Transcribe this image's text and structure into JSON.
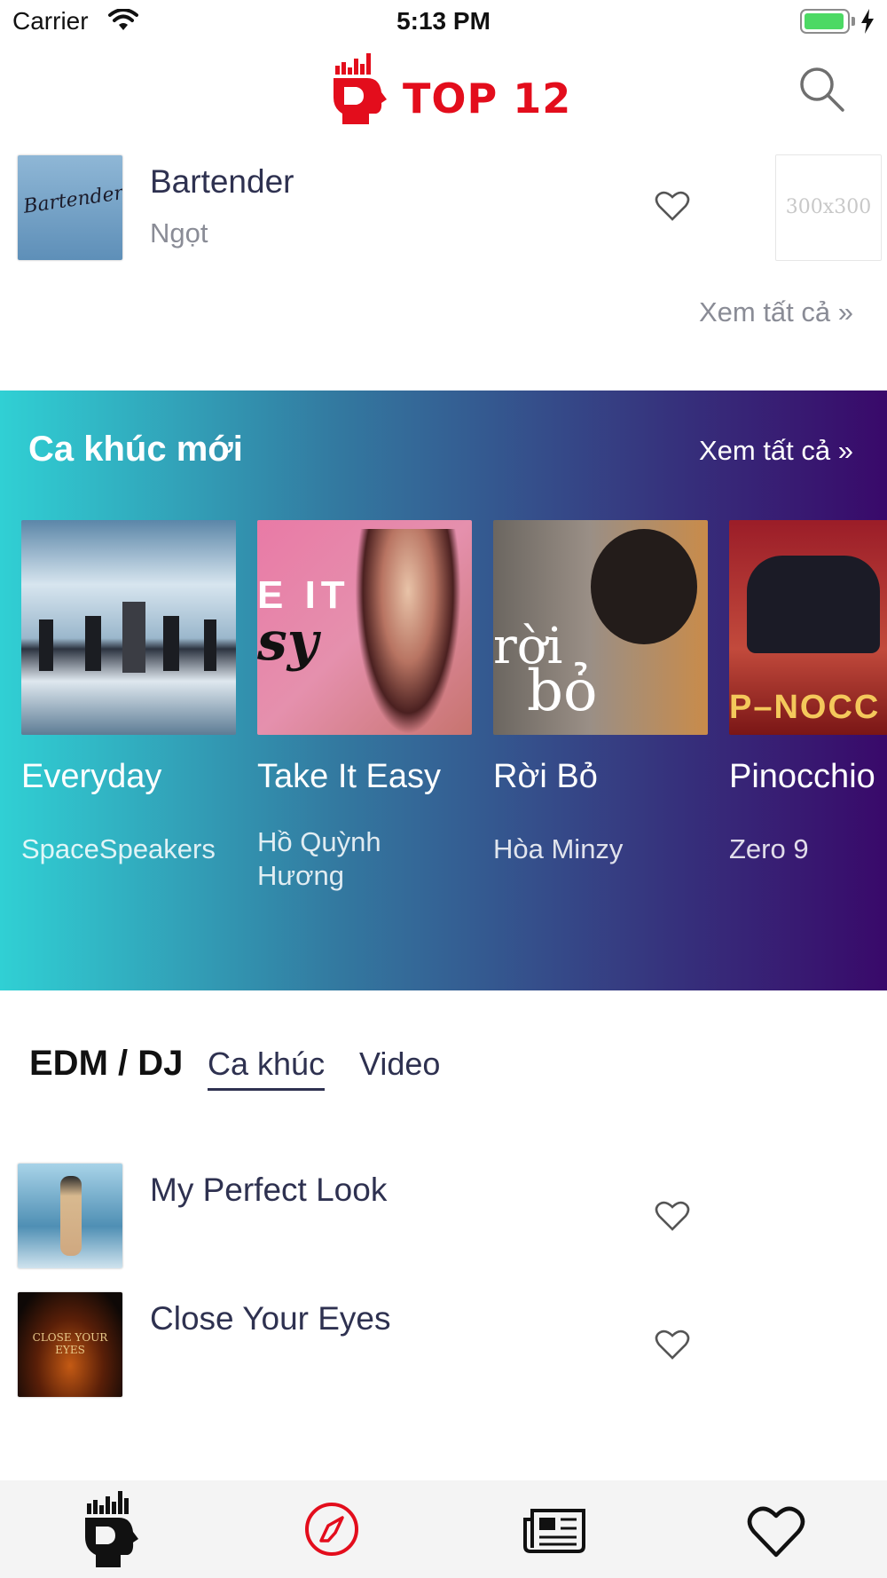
{
  "status_bar": {
    "carrier": "Carrier",
    "time": "5:13 PM"
  },
  "header": {
    "logo_text": "TOP 12"
  },
  "top_song": {
    "title": "Bartender",
    "artist": "Ngọt",
    "cover_text": "Bartender",
    "placeholder": "300x300"
  },
  "see_all": "Xem tất cả »",
  "new_songs": {
    "title": "Ca khúc mới",
    "see_all": "Xem tất cả »",
    "items": [
      {
        "title": "Everyday",
        "artist": "SpaceSpeakers"
      },
      {
        "title": "Take It Easy",
        "artist": "Hồ Quỳnh Hương"
      },
      {
        "title": "Rời Bỏ",
        "artist": "Hòa Minzy"
      },
      {
        "title": "Pinocchio",
        "artist": "Zero 9"
      }
    ]
  },
  "category": {
    "title": "EDM / DJ",
    "tabs": [
      "Ca khúc",
      "Video"
    ],
    "songs": [
      {
        "title": "My Perfect Look"
      },
      {
        "title": "Close Your Eyes",
        "cover_text": "CLOSE YOUR EYES"
      }
    ]
  },
  "colors": {
    "brand_red": "#e30d1c",
    "text_dark": "#2e3150",
    "gradient_start": "#30d0d4",
    "gradient_end": "#39096a"
  },
  "tab_bar_icons": [
    "logo-head-icon",
    "compass-icon",
    "newspaper-icon",
    "heart-icon"
  ]
}
